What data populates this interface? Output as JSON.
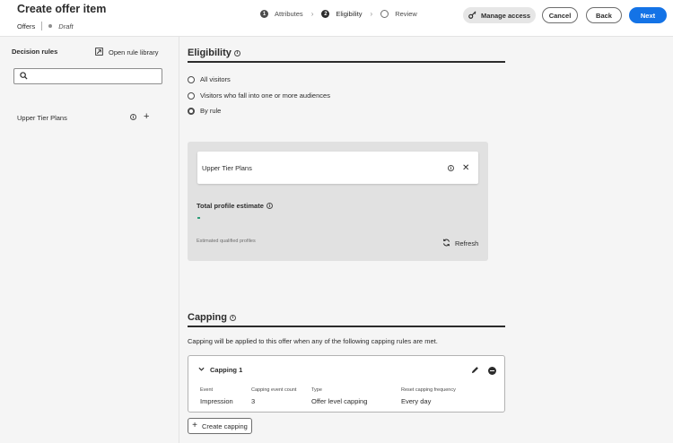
{
  "header": {
    "title": "Create offer item",
    "breadcrumb": "Offers",
    "status": "Draft",
    "steps": [
      {
        "num": "1",
        "label": "Attributes"
      },
      {
        "num": "2",
        "label": "Eligibility"
      },
      {
        "num": "",
        "label": "Review"
      }
    ],
    "manage_access": "Manage access",
    "cancel": "Cancel",
    "back": "Back",
    "next": "Next"
  },
  "sidebar": {
    "title": "Decision rules",
    "open_library": "Open rule library",
    "search_placeholder": "",
    "rules": [
      {
        "label": "Upper Tier Plans"
      }
    ]
  },
  "eligibility": {
    "title": "Eligibility",
    "options": [
      {
        "label": "All visitors",
        "selected": false
      },
      {
        "label": "Visitors who fall into one or more audiences",
        "selected": false
      },
      {
        "label": "By rule",
        "selected": true
      }
    ],
    "selected_rule": "Upper Tier Plans",
    "total_profile_estimate": "Total profile estimate",
    "estimate_value": "-",
    "estimated_qualified": "Estimated qualified profiles",
    "refresh": "Refresh"
  },
  "capping": {
    "title": "Capping",
    "description": "Capping will be applied to this offer when any of the following capping rules are met.",
    "rule": {
      "name": "Capping 1",
      "columns": [
        {
          "header": "Event",
          "value": "Impression"
        },
        {
          "header": "Capping event count",
          "value": "3"
        },
        {
          "header": "Type",
          "value": "Offer level capping"
        },
        {
          "header": "Reset capping frequency",
          "value": "Every day"
        }
      ]
    },
    "create_button": "Create capping"
  },
  "colors": {
    "accent": "#1473e6",
    "text": "#2c2c2c",
    "estimate": "#2d9d78"
  }
}
